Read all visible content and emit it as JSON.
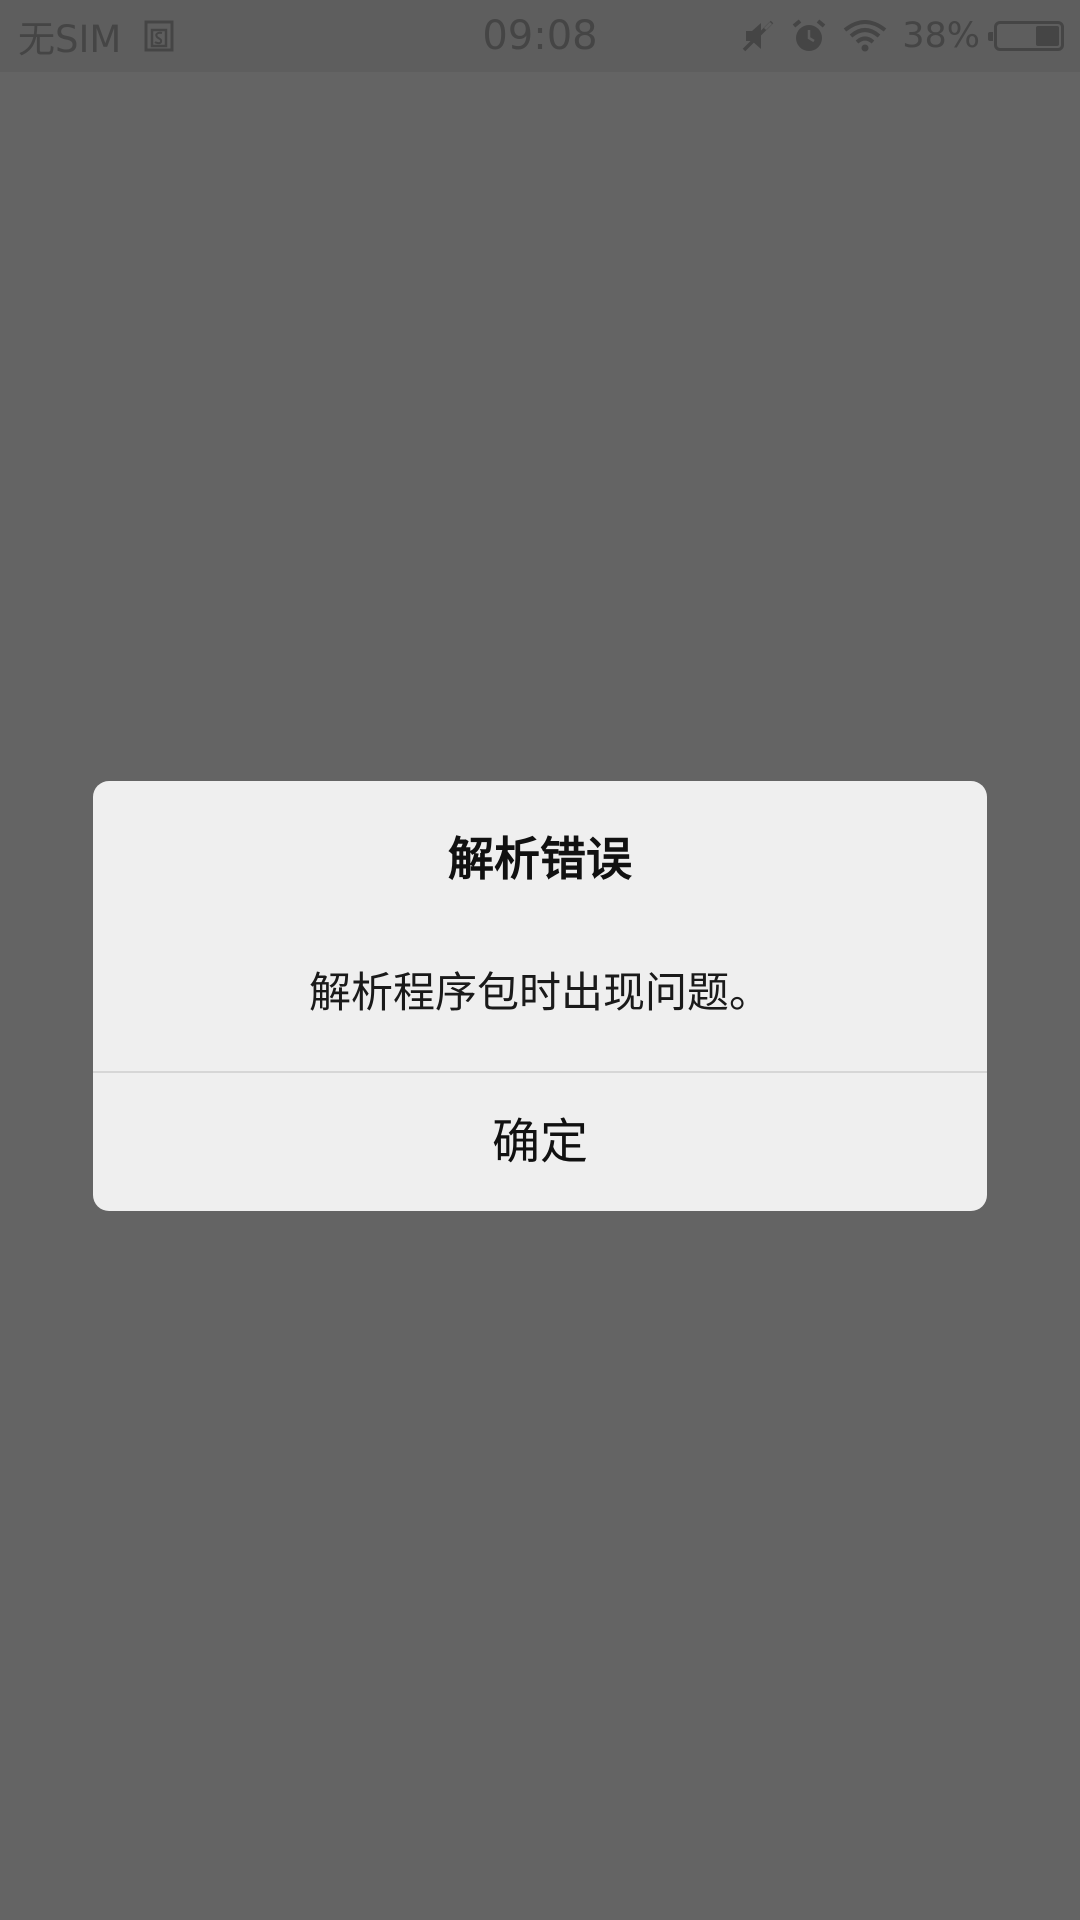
{
  "status_bar": {
    "carrier": "无SIM",
    "time": "09:08",
    "battery_percent": "38%",
    "battery_level": 0.38,
    "icons": [
      "sim-card-icon",
      "mute-icon",
      "alarm-icon",
      "wifi-icon",
      "battery-icon"
    ]
  },
  "dialog": {
    "title": "解析错误",
    "message": "解析程序包时出现问题。",
    "confirm_label": "确定"
  },
  "colors": {
    "background": "#646464",
    "dialog": "#efefef",
    "status_text": "#454545"
  }
}
